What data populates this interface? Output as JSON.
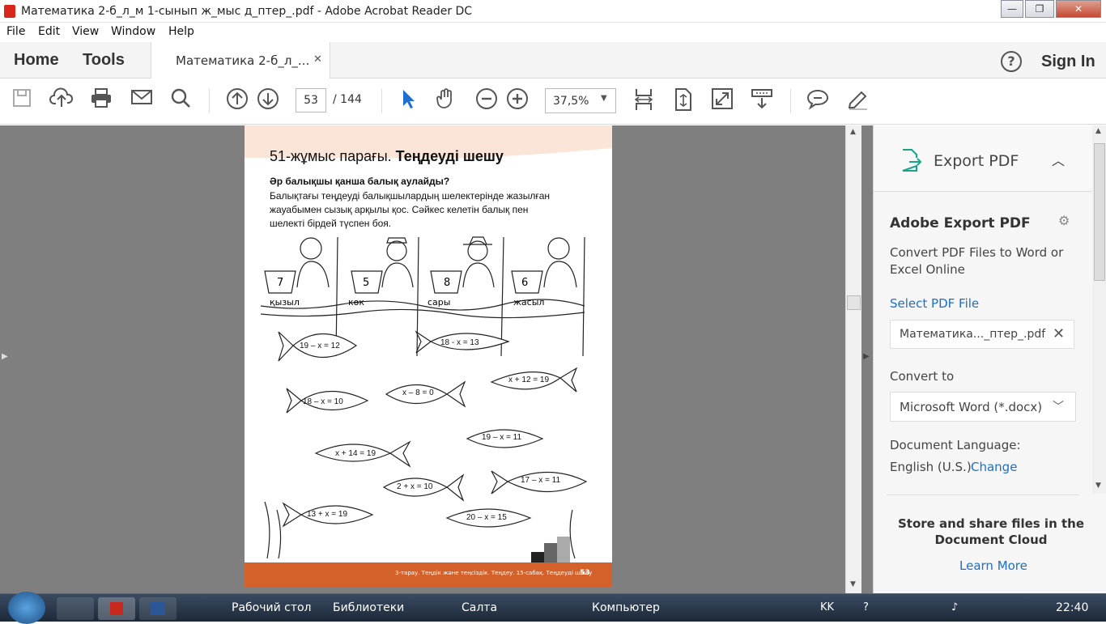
{
  "window": {
    "title": "Математика 2-б_л_м 1-сынып ж_мыс д_птер_.pdf - Adobe Acrobat Reader DC",
    "min": "—",
    "max": "❐",
    "close": "✕"
  },
  "menu": [
    "File",
    "Edit",
    "View",
    "Window",
    "Help"
  ],
  "nav": {
    "home": "Home",
    "tools": "Tools",
    "tab": "Математика 2-б_л_...",
    "tab_close": "✕",
    "help": "?",
    "signin": "Sign In"
  },
  "toolbar": {
    "page": "53",
    "pages": "/  144",
    "zoom": "37,5%"
  },
  "page": {
    "heading_prefix": "51-жұмыс парағы.",
    "heading_bold": "Теңдеуді шешу",
    "question": "Әр балықшы қанша балық аулайды?",
    "instr1": "Балықтағы теңдеуді балықшылардың шелектерінде жазылған",
    "instr2": "жауабымен сызық арқылы қос. Сәйкес келетін балық пен",
    "instr3": "шелекті бірдей түспен боя.",
    "buckets": [
      "7",
      "5",
      "8",
      "6"
    ],
    "colors": [
      "қызыл",
      "көк",
      "сары",
      "жасыл"
    ],
    "fish": [
      "19 – x = 12",
      "18 - x = 13",
      "18 – x = 10",
      "x – 8 = 0",
      "x + 12 = 19",
      "19 – x = 11",
      "x + 14 = 19",
      "2 + x = 10",
      "17 – x = 11",
      "13 + x = 19",
      "20 – x = 15"
    ],
    "footer": "3-тарау. Теңдік және теңсіздік. Теңдеу. 15-сабақ. Теңдеуді шешу",
    "page_no": "53"
  },
  "panel": {
    "export_title": "Export PDF",
    "adobe_title": "Adobe Export PDF",
    "desc": "Convert PDF Files to Word or Excel Online",
    "select": "Select PDF File",
    "file": "Математика..._птер_.pdf",
    "convert_to": "Convert to",
    "format": "Microsoft Word (*.docx)",
    "lang_label": "Document Language:",
    "lang": "English (U.S.)",
    "change": "Change",
    "store": "Store and share files in the Document Cloud",
    "learn": "Learn More"
  },
  "taskbar": {
    "desktop": "Рабочий стол",
    "lib": "Библиотеки",
    "salta": "Салта",
    "comp": "Компьютер",
    "lang": "KK",
    "time": "22:40"
  }
}
